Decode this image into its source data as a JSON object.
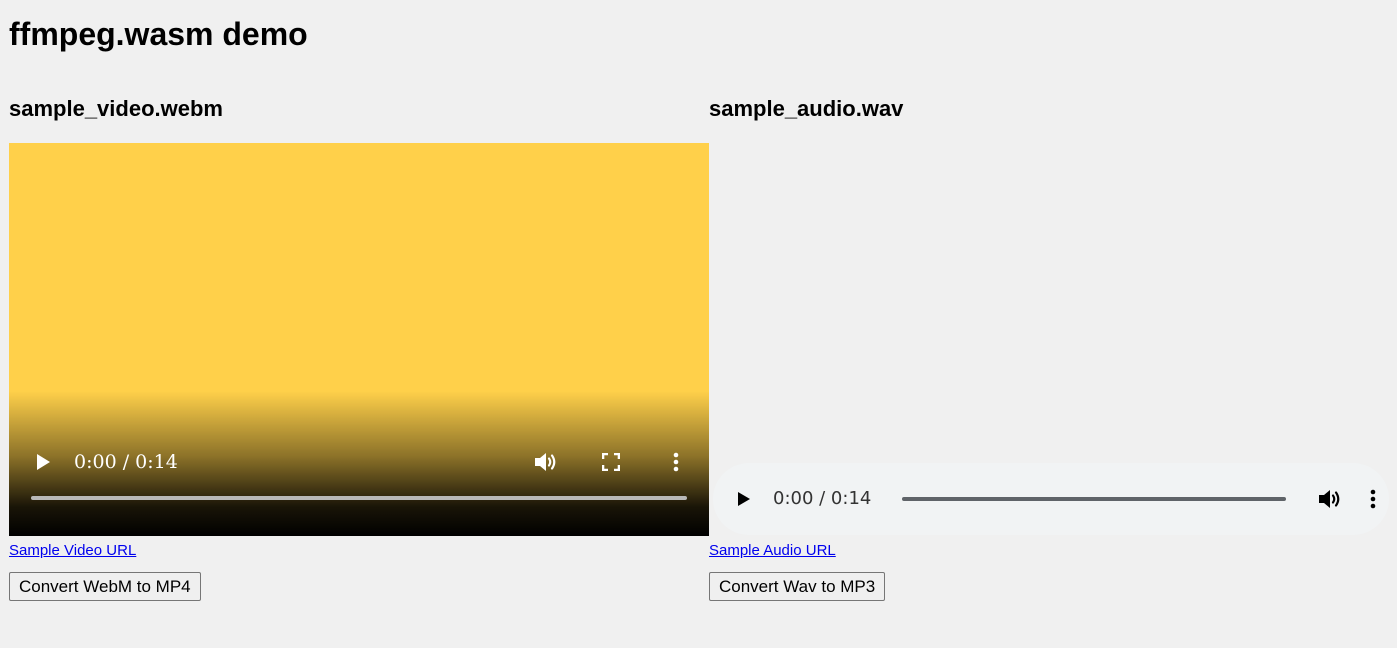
{
  "page": {
    "title": "ffmpeg.wasm demo"
  },
  "video": {
    "heading": "sample_video.webm",
    "poster_color": "#ffd04a",
    "player": {
      "time_display": "0:00 / 0:14",
      "progress": 0,
      "icons": [
        "play-icon",
        "volume-icon",
        "fullscreen-icon",
        "more-options-icon"
      ]
    },
    "link_text": "Sample Video URL",
    "convert_label": "Convert WebM to MP4"
  },
  "audio": {
    "heading": "sample_audio.wav",
    "player": {
      "time_display": "0:00 / 0:14",
      "progress": 0,
      "icons": [
        "play-icon",
        "volume-icon",
        "more-options-icon"
      ]
    },
    "link_text": "Sample Audio URL",
    "convert_label": "Convert Wav to MP3"
  },
  "colors": {
    "background": "#f0f0f0",
    "link": "#0000ee",
    "audio_player_bg": "#f1f3f4"
  }
}
